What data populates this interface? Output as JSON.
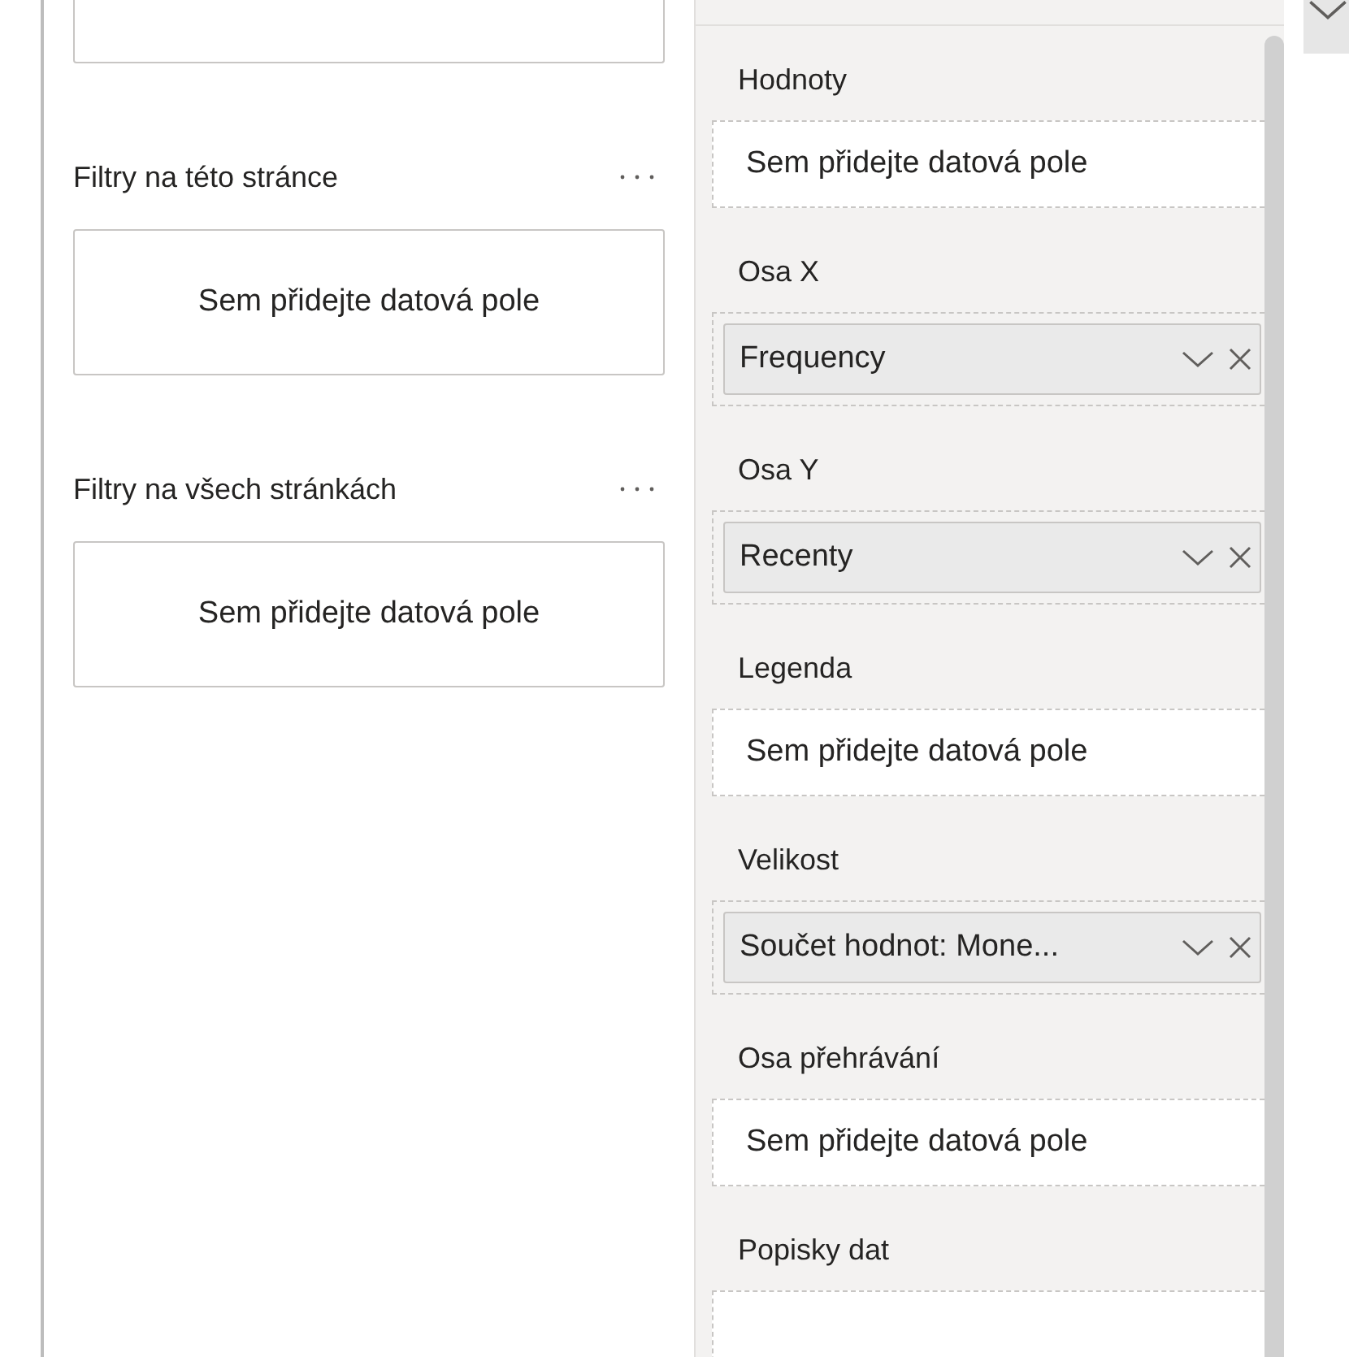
{
  "filters": {
    "sections": [
      {
        "title": "Filtry na této stránce",
        "placeholder": "Sem přidejte datová pole"
      },
      {
        "title": "Filtry na všech stránkách",
        "placeholder": "Sem přidejte datová pole"
      }
    ]
  },
  "wells": [
    {
      "label": "Hodnoty",
      "kind": "empty",
      "text": "Sem přidejte datová pole"
    },
    {
      "label": "Osa X",
      "kind": "field",
      "text": "Frequency"
    },
    {
      "label": "Osa Y",
      "kind": "field",
      "text": "Recenty"
    },
    {
      "label": "Legenda",
      "kind": "empty",
      "text": "Sem přidejte datová pole"
    },
    {
      "label": "Velikost",
      "kind": "field",
      "text": "Součet hodnot: Mone..."
    },
    {
      "label": "Osa přehrávání",
      "kind": "empty",
      "text": "Sem přidejte datová pole"
    },
    {
      "label": "Popisky dat",
      "kind": "empty"
    }
  ]
}
